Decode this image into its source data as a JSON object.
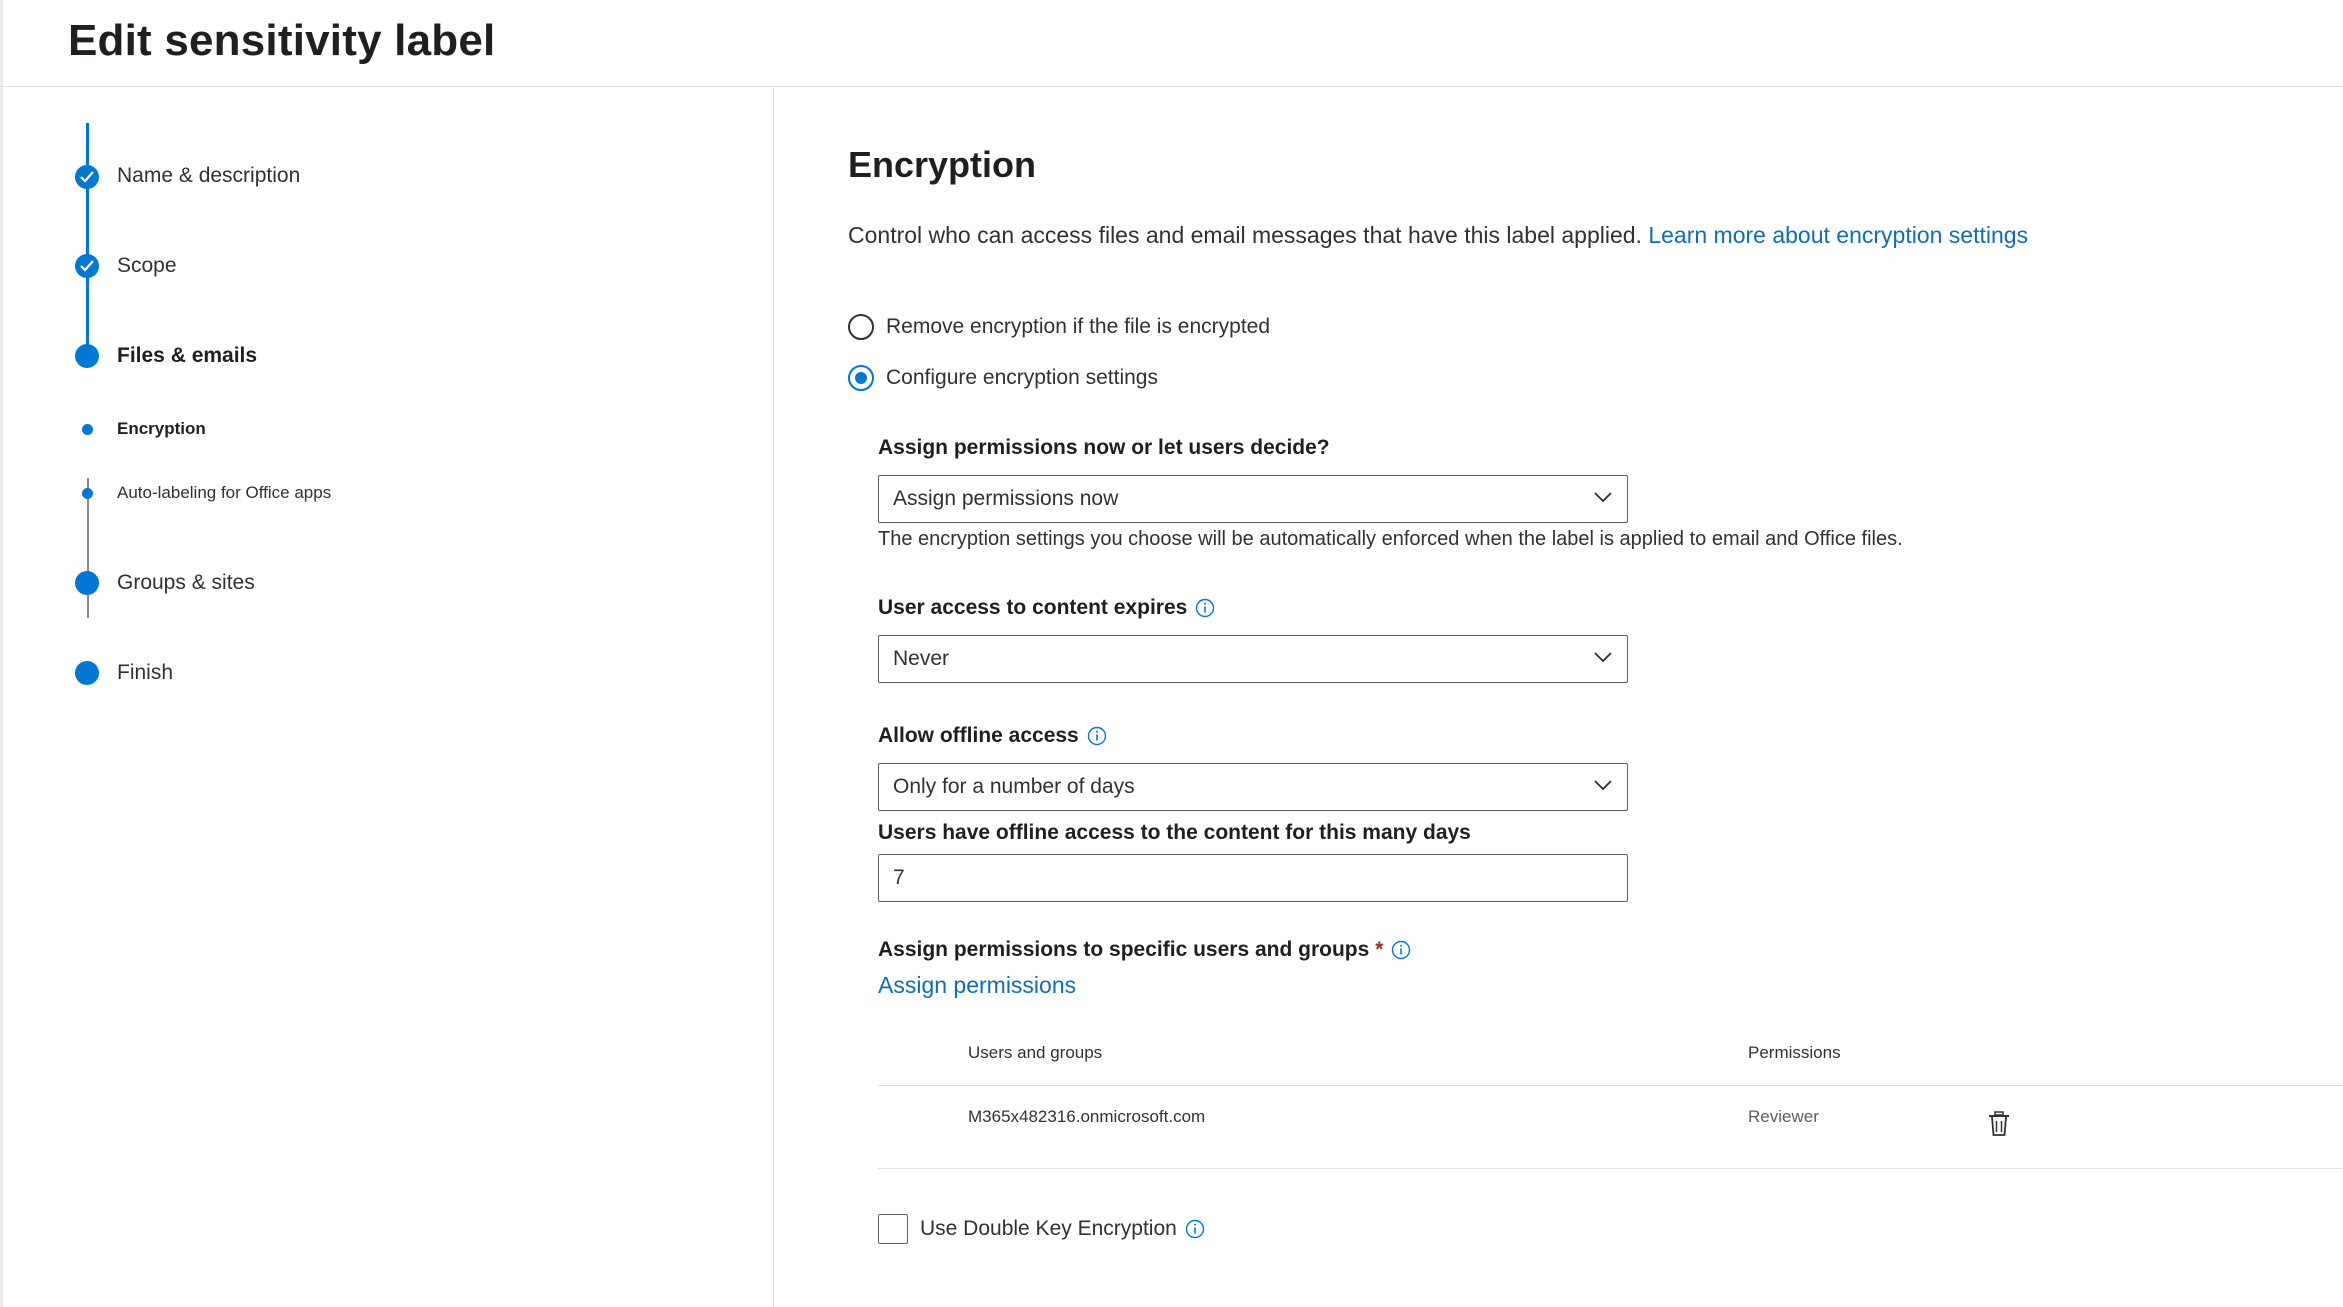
{
  "header": {
    "title": "Edit sensitivity label"
  },
  "nav": {
    "steps": [
      {
        "label": "Name & description",
        "state": "completed"
      },
      {
        "label": "Scope",
        "state": "completed"
      },
      {
        "label": "Files & emails",
        "state": "current"
      },
      {
        "label": "Encryption",
        "state": "current-substep"
      },
      {
        "label": "Auto-labeling for Office apps",
        "state": "substep"
      },
      {
        "label": "Groups & sites",
        "state": "upcoming"
      },
      {
        "label": "Finish",
        "state": "upcoming"
      }
    ]
  },
  "main": {
    "title": "Encryption",
    "description": "Control who can access files and email messages that have this label applied.",
    "learn_more_link": "Learn more about encryption settings",
    "radio_options": [
      {
        "label": "Remove encryption if the file is encrypted",
        "checked": false
      },
      {
        "label": "Configure encryption settings",
        "checked": true
      }
    ],
    "assign_mode": {
      "label": "Assign permissions now or let users decide?",
      "value": "Assign permissions now",
      "helper": "The encryption settings you choose will be automatically enforced when the label is applied to email and Office files."
    },
    "expiry": {
      "label": "User access to content expires",
      "value": "Never"
    },
    "offline": {
      "label": "Allow offline access",
      "value": "Only for a number of days",
      "days_label": "Users have offline access to the content for this many days",
      "days_value": "7"
    },
    "assign_specific": {
      "label": "Assign permissions to specific users and groups",
      "required_marker": "*",
      "link": "Assign permissions"
    },
    "permissions_table": {
      "columns": [
        "Users and groups",
        "Permissions"
      ],
      "rows": [
        {
          "user": "M365x482316.onmicrosoft.com",
          "permission": "Reviewer"
        }
      ]
    },
    "double_key": {
      "label": "Use Double Key Encryption",
      "checked": false
    }
  },
  "colors": {
    "accent": "#0078d4",
    "link": "#0f6cbd",
    "required": "#a4262c"
  }
}
